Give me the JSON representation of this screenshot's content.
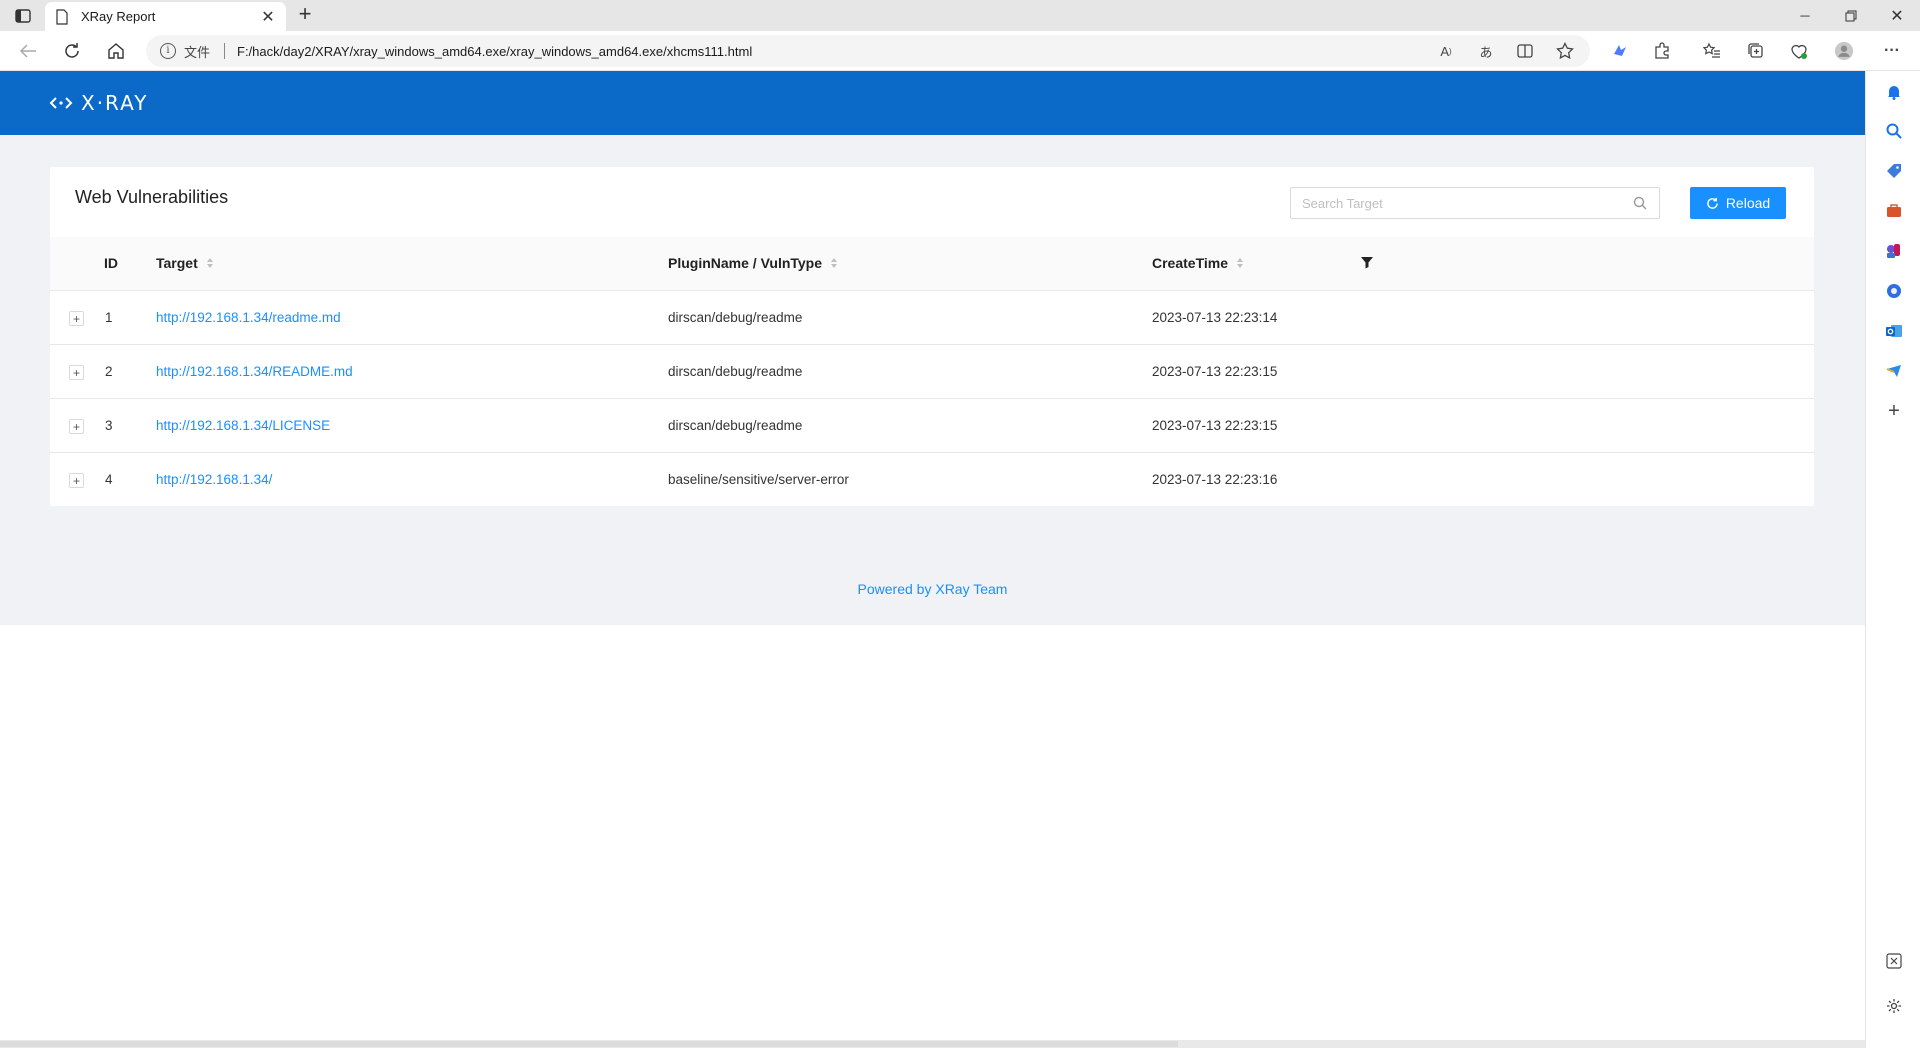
{
  "browser": {
    "tab_title": "XRay Report",
    "address_scheme_label": "文件",
    "url": "F:/hack/day2/XRAY/xray_windows_amd64.exe/xray_windows_amd64.exe/xhcms111.html",
    "read_aloud_label": "A",
    "translate_label": "あ",
    "menu_label": "···"
  },
  "app": {
    "logo_text": "X·RAY",
    "card_title": "Web Vulnerabilities",
    "search_placeholder": "Search Target",
    "reload_label": "Reload",
    "columns": {
      "id": "ID",
      "target": "Target",
      "plugin": "PluginName / VulnType",
      "time": "CreateTime"
    },
    "rows": [
      {
        "id": "1",
        "target": "http://192.168.1.34/readme.md",
        "plugin": "dirscan/debug/readme",
        "time": "2023-07-13 22:23:14"
      },
      {
        "id": "2",
        "target": "http://192.168.1.34/README.md",
        "plugin": "dirscan/debug/readme",
        "time": "2023-07-13 22:23:15"
      },
      {
        "id": "3",
        "target": "http://192.168.1.34/LICENSE",
        "plugin": "dirscan/debug/readme",
        "time": "2023-07-13 22:23:15"
      },
      {
        "id": "4",
        "target": "http://192.168.1.34/",
        "plugin": "baseline/sensitive/server-error",
        "time": "2023-07-13 22:23:16"
      }
    ],
    "expand_symbol": "+",
    "footer": "Powered by XRay Team"
  },
  "colors": {
    "header": "#0b69c7",
    "primary": "#1890ff",
    "page_bg": "#f0f2f5"
  }
}
